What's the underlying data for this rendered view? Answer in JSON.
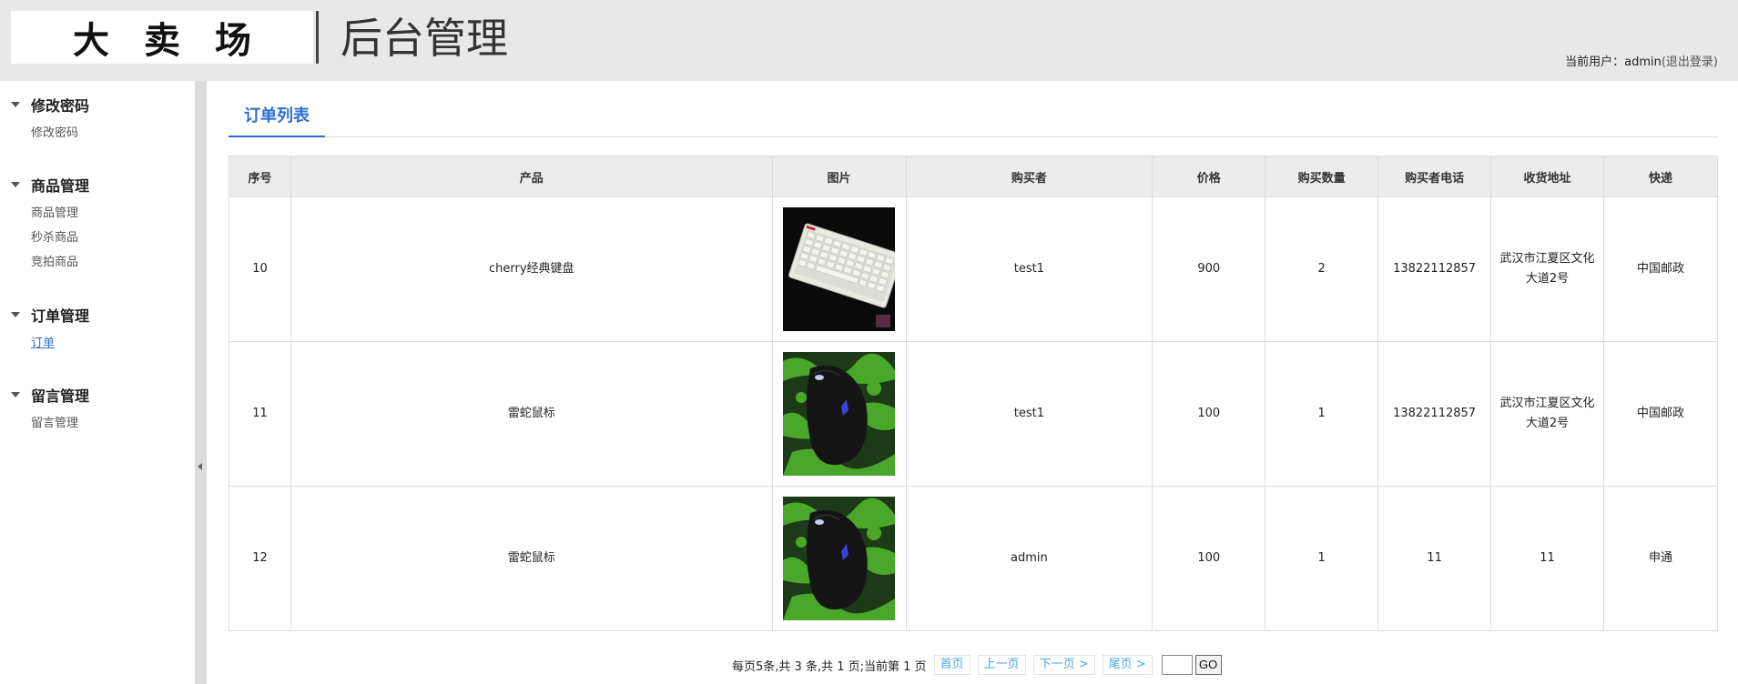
{
  "header": {
    "logo": "大卖场",
    "title": "后台管理",
    "user_label": "当前用户：",
    "username": "admin",
    "logout": "(退出登录)"
  },
  "sidebar": {
    "groups": [
      {
        "title": "修改密码",
        "items": [
          "修改密码"
        ]
      },
      {
        "title": "商品管理",
        "items": [
          "商品管理",
          "秒杀商品",
          "竞拍商品"
        ]
      },
      {
        "title": "订单管理",
        "items": [
          "订单"
        ]
      },
      {
        "title": "留言管理",
        "items": [
          "留言管理"
        ]
      }
    ],
    "active_item": "订单"
  },
  "main": {
    "tab": "订单列表",
    "columns": [
      "序号",
      "产品",
      "图片",
      "购买者",
      "价格",
      "购买数量",
      "购买者电话",
      "收货地址",
      "快递"
    ],
    "rows": [
      {
        "id": "10",
        "product": "cherry经典键盘",
        "image": "keyboard-image",
        "buyer": "test1",
        "price": "900",
        "qty": "2",
        "phone": "13822112857",
        "address": "武汉市江夏区文化大道2号",
        "express": "中国邮政"
      },
      {
        "id": "11",
        "product": "雷蛇鼠标",
        "image": "mouse-image",
        "buyer": "test1",
        "price": "100",
        "qty": "1",
        "phone": "13822112857",
        "address": "武汉市江夏区文化大道2号",
        "express": "中国邮政"
      },
      {
        "id": "12",
        "product": "雷蛇鼠标",
        "image": "mouse-image",
        "buyer": "admin",
        "price": "100",
        "qty": "1",
        "phone": "11",
        "address": "11",
        "express": "申通"
      }
    ]
  },
  "pager": {
    "summary": "每页5条,共 3 条,共 1 页;当前第 1 页",
    "first": "首页",
    "prev": "上一页",
    "next": "下一页 >",
    "last": "尾页 >",
    "page_value": "",
    "go": "GO"
  }
}
